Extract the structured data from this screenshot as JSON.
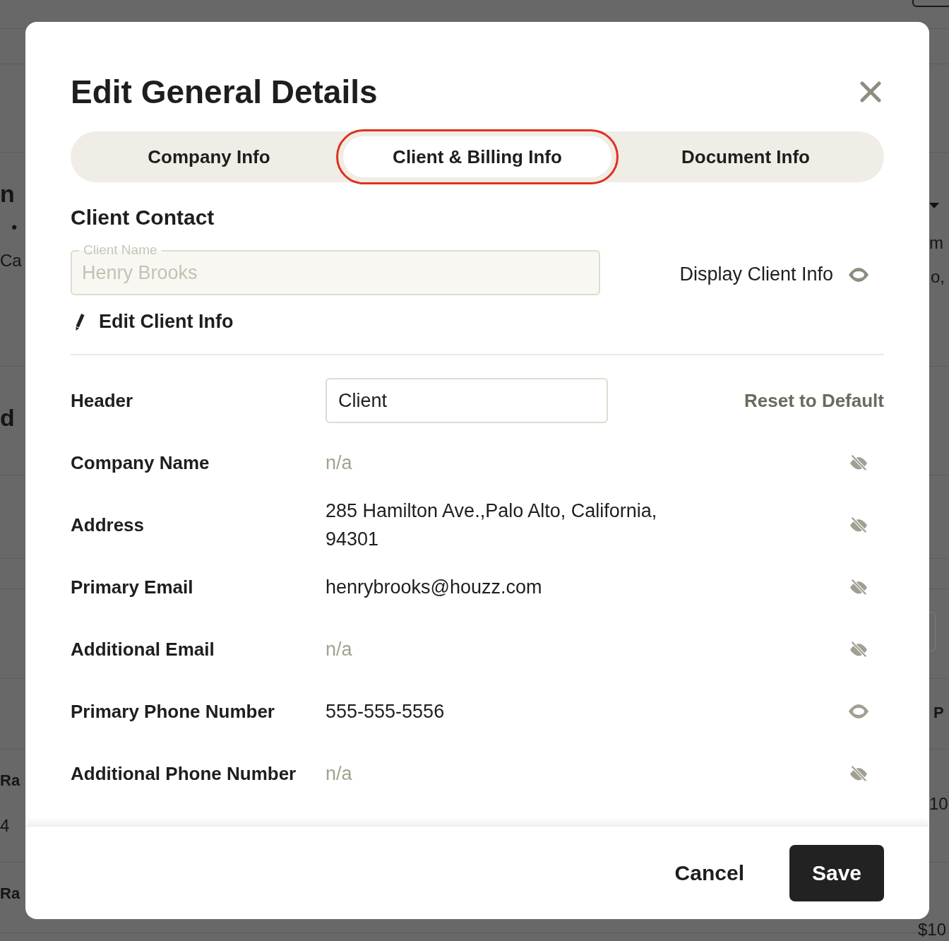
{
  "background": {
    "left_texts": [
      {
        "text": "n",
        "kind": "heading"
      },
      {
        "text": "•",
        "kind": "text"
      },
      {
        "text": "Ca",
        "kind": "text"
      },
      {
        "text": "d",
        "kind": "heading"
      },
      {
        "text": "Ra",
        "kind": "label"
      },
      {
        "text": "4",
        "kind": "text"
      },
      {
        "text": "Ra",
        "kind": "label"
      }
    ],
    "right_texts": [
      {
        "text": "m",
        "kind": "text"
      },
      {
        "text": "o,",
        "kind": "text"
      },
      {
        "text": "P",
        "kind": "label"
      },
      {
        "text": "10",
        "kind": "text"
      },
      {
        "text": "$10",
        "kind": "text"
      }
    ]
  },
  "dialog": {
    "title": "Edit General Details",
    "tabs": [
      {
        "label": "Company Info",
        "selected": false
      },
      {
        "label": "Client & Billing Info",
        "selected": true
      },
      {
        "label": "Document Info",
        "selected": false
      }
    ],
    "section_title": "Client Contact",
    "client_name": {
      "label": "Client Name",
      "value": "Henry Brooks",
      "disabled": true
    },
    "display_toggle": {
      "label": "Display Client Info",
      "visible": true
    },
    "edit_link": "Edit Client Info",
    "header_field": {
      "label": "Header",
      "value": "Client"
    },
    "reset_link": "Reset to Default",
    "rows": [
      {
        "label": "Company Name",
        "value": "n/a",
        "empty": true,
        "visible": false
      },
      {
        "label": "Address",
        "value": "285 Hamilton Ave.,Palo Alto, California, 94301",
        "empty": false,
        "visible": false
      },
      {
        "label": "Primary Email",
        "value": "henrybrooks@houzz.com",
        "empty": false,
        "visible": false
      },
      {
        "label": "Additional Email",
        "value": "n/a",
        "empty": true,
        "visible": false
      },
      {
        "label": "Primary Phone Number",
        "value": "555-555-5556",
        "empty": false,
        "visible": true
      },
      {
        "label": "Additional Phone Number",
        "value": "n/a",
        "empty": true,
        "visible": false
      }
    ],
    "buttons": {
      "cancel": "Cancel",
      "save": "Save"
    }
  }
}
